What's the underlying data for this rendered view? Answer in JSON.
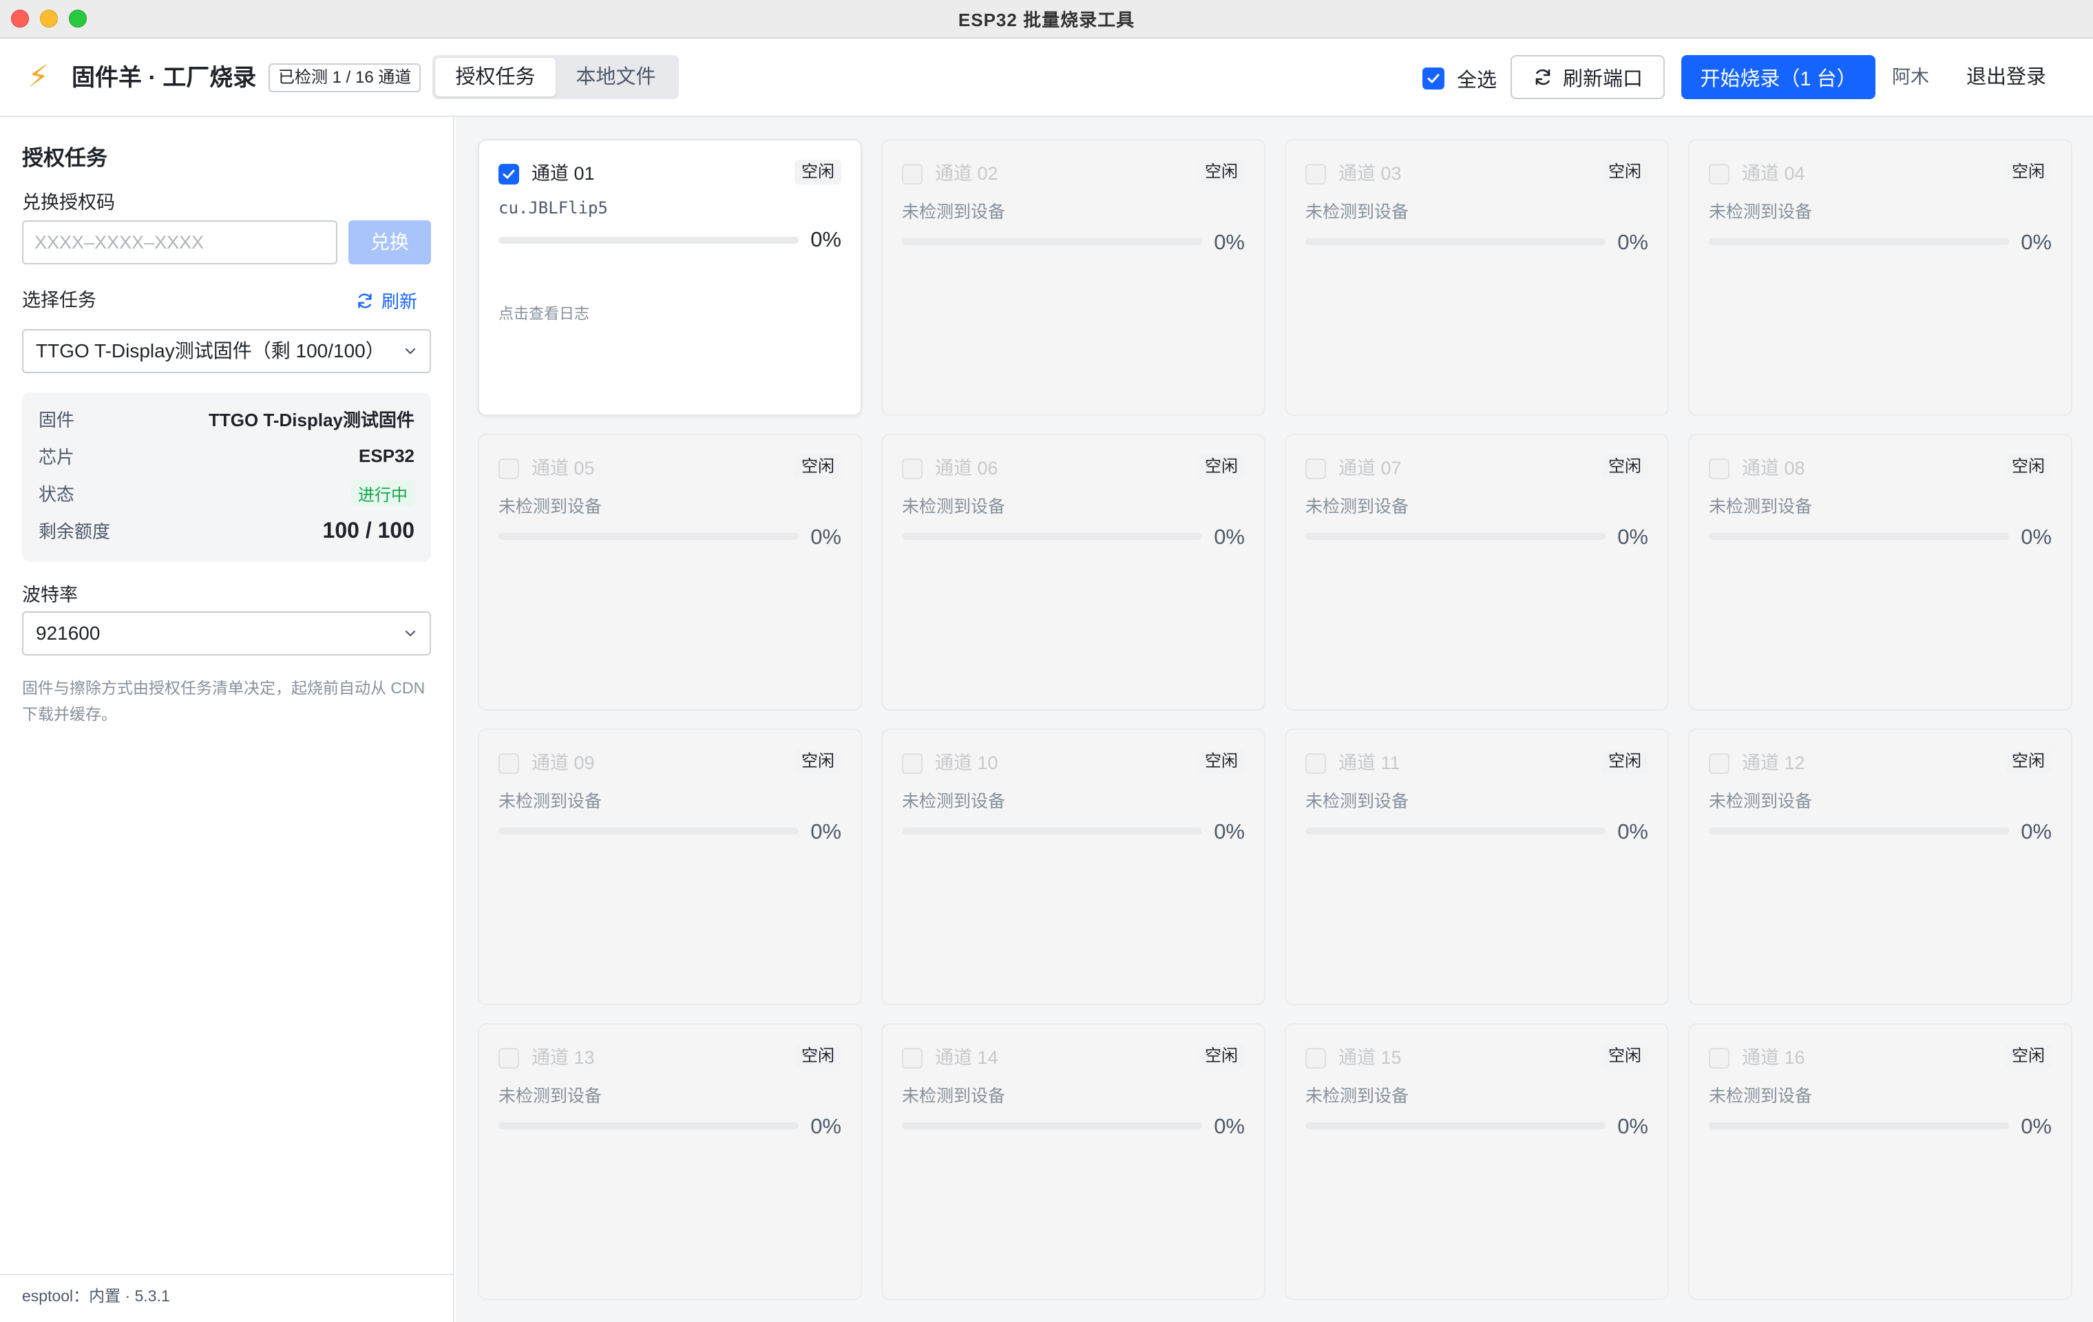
{
  "window": {
    "title": "ESP32 批量烧录工具"
  },
  "header": {
    "brand": "固件羊 · 工厂烧录",
    "detect_badge": "已检测 1 / 16 通道",
    "tabs": [
      {
        "label": "授权任务",
        "active": true
      },
      {
        "label": "本地文件",
        "active": false
      }
    ],
    "select_all_label": "全选",
    "select_all_checked": true,
    "refresh_ports_label": "刷新端口",
    "start_label": "开始烧录（1 台）",
    "user_name": "阿木",
    "logout_label": "退出登录"
  },
  "sidebar": {
    "title": "授权任务",
    "redeem_label": "兑换授权码",
    "redeem_placeholder": "XXXX–XXXX–XXXX",
    "redeem_button": "兑换",
    "task_label": "选择任务",
    "refresh_label": "刷新",
    "task_selected": "TTGO T-Display测试固件（剩 100/100）",
    "info": {
      "firmware_key": "固件",
      "firmware_value": "TTGO T-Display测试固件",
      "chip_key": "芯片",
      "chip_value": "ESP32",
      "status_key": "状态",
      "status_value": "进行中",
      "quota_key": "剩余额度",
      "quota_value": "100 / 100"
    },
    "baud_label": "波特率",
    "baud_selected": "921600",
    "note": "固件与擦除方式由授权任务清单决定，起烧前自动从 CDN 下载并缓存。",
    "footer": "esptool：内置 · 5.3.1"
  },
  "channels": [
    {
      "name": "通道 01",
      "state": "空闲",
      "device": "cu.JBLFlip5",
      "progress": "0%",
      "log": "点击查看日志",
      "checked": true,
      "active": true
    },
    {
      "name": "通道 02",
      "state": "空闲",
      "device": "未检测到设备",
      "progress": "0%"
    },
    {
      "name": "通道 03",
      "state": "空闲",
      "device": "未检测到设备",
      "progress": "0%"
    },
    {
      "name": "通道 04",
      "state": "空闲",
      "device": "未检测到设备",
      "progress": "0%"
    },
    {
      "name": "通道 05",
      "state": "空闲",
      "device": "未检测到设备",
      "progress": "0%"
    },
    {
      "name": "通道 06",
      "state": "空闲",
      "device": "未检测到设备",
      "progress": "0%"
    },
    {
      "name": "通道 07",
      "state": "空闲",
      "device": "未检测到设备",
      "progress": "0%"
    },
    {
      "name": "通道 08",
      "state": "空闲",
      "device": "未检测到设备",
      "progress": "0%"
    },
    {
      "name": "通道 09",
      "state": "空闲",
      "device": "未检测到设备",
      "progress": "0%"
    },
    {
      "name": "通道 10",
      "state": "空闲",
      "device": "未检测到设备",
      "progress": "0%"
    },
    {
      "name": "通道 11",
      "state": "空闲",
      "device": "未检测到设备",
      "progress": "0%"
    },
    {
      "name": "通道 12",
      "state": "空闲",
      "device": "未检测到设备",
      "progress": "0%"
    },
    {
      "name": "通道 13",
      "state": "空闲",
      "device": "未检测到设备",
      "progress": "0%"
    },
    {
      "name": "通道 14",
      "state": "空闲",
      "device": "未检测到设备",
      "progress": "0%"
    },
    {
      "name": "通道 15",
      "state": "空闲",
      "device": "未检测到设备",
      "progress": "0%"
    },
    {
      "name": "通道 16",
      "state": "空闲",
      "device": "未检测到设备",
      "progress": "0%"
    }
  ],
  "colors": {
    "accent": "#1664ff",
    "warning": "#f5a623",
    "success": "#14a44d"
  },
  "icons": {
    "brand": "lightning-icon",
    "refresh": "refresh-icon",
    "dropdown": "chevron-down-icon",
    "check": "check-icon"
  }
}
